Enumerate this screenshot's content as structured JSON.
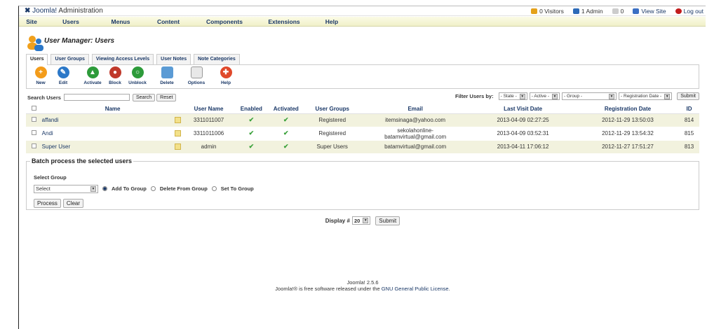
{
  "app": {
    "logo_text": "Joomla!",
    "logo_sub": "Administration"
  },
  "status": {
    "visitors": "0 Visitors",
    "admin": "1 Admin",
    "messages": "0",
    "view_site": "View Site",
    "logout": "Log out"
  },
  "menu": [
    "Site",
    "Users",
    "Menus",
    "Content",
    "Components",
    "Extensions",
    "Help"
  ],
  "page_title": "User Manager: Users",
  "tabs": [
    "Users",
    "User Groups",
    "Viewing Access Levels",
    "User Notes",
    "Note Categories"
  ],
  "toolbar": [
    {
      "label": "New",
      "icon": "new-icon",
      "color": "#f39c1a"
    },
    {
      "label": "Edit",
      "icon": "edit-icon",
      "color": "#2c78c8"
    },
    {
      "label": "Activate",
      "icon": "activate-icon",
      "color": "#2d9b3a"
    },
    {
      "label": "Block",
      "icon": "block-icon",
      "color": "#c0392b"
    },
    {
      "label": "Unblock",
      "icon": "unblock-icon",
      "color": "#2d9b3a"
    },
    {
      "label": "Delete",
      "icon": "delete-icon",
      "color": "#2c78c8"
    },
    {
      "label": "Options",
      "icon": "options-icon",
      "color": "#888"
    },
    {
      "label": "Help",
      "icon": "help-icon",
      "color": "#e0492b"
    }
  ],
  "search": {
    "label": "Search Users",
    "value": "",
    "search_btn": "Search",
    "reset_btn": "Reset"
  },
  "filter": {
    "label": "Filter Users by:",
    "state": "- State -",
    "active": "- Active -",
    "group": "- Group -",
    "regdate": "- Registration Date -",
    "submit": "Submit"
  },
  "table": {
    "headers": [
      "Name",
      "User Name",
      "Enabled",
      "Activated",
      "User Groups",
      "Email",
      "Last Visit Date",
      "Registration Date",
      "ID"
    ],
    "rows": [
      {
        "name": "affandi",
        "username": "3311011007",
        "enabled": "✔",
        "activated": "✔",
        "groups": "Registered",
        "email": "itemsinaga@yahoo.com",
        "email2": "",
        "last_visit": "2013-04-09 02:27:25",
        "registered": "2012-11-29 13:50:03",
        "id": "814"
      },
      {
        "name": "Andi",
        "username": "3311011006",
        "enabled": "✔",
        "activated": "✔",
        "groups": "Registered",
        "email": "sekolahonline-",
        "email2": "batamvirtual@gmail.com",
        "last_visit": "2013-04-09 03:52:31",
        "registered": "2012-11-29 13:54:32",
        "id": "815"
      },
      {
        "name": "Super User",
        "username": "admin",
        "enabled": "✔",
        "activated": "✔",
        "groups": "Super Users",
        "email": "batamvirtual@gmail.com",
        "email2": "",
        "last_visit": "2013-04-11 17:06:12",
        "registered": "2012-11-27 17:51:27",
        "id": "813"
      }
    ]
  },
  "batch": {
    "title": "Batch process the selected users",
    "select_group_label": "Select Group",
    "select_value": "Select",
    "options": [
      "Add To Group",
      "Delete From Group",
      "Set To Group"
    ],
    "process_btn": "Process",
    "clear_btn": "Clear"
  },
  "pager": {
    "label": "Display #",
    "value": "20",
    "submit": "Submit"
  },
  "footer": {
    "version": "Joomla! 2.5.6",
    "prefix": "Joomla!® is free software released under the ",
    "link": "GNU General Public License",
    "suffix": "."
  }
}
